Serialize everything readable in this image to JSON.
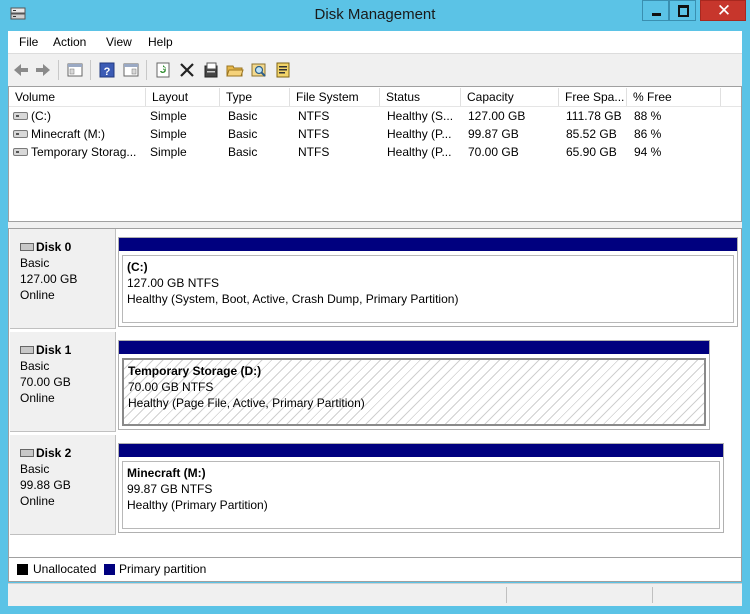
{
  "window": {
    "title": "Disk Management"
  },
  "menu": [
    "File",
    "Action",
    "View",
    "Help"
  ],
  "toolbar_icons": [
    "back-arrow-icon",
    "forward-arrow-icon",
    "console-tree-icon",
    "help-icon",
    "properties-pane-icon",
    "refresh-icon",
    "delete-icon",
    "properties-icon",
    "open-icon",
    "explore-icon",
    "export-icon"
  ],
  "volumes": {
    "columns": [
      "Volume",
      "Layout",
      "Type",
      "File System",
      "Status",
      "Capacity",
      "Free Spa...",
      "% Free"
    ],
    "rows": [
      {
        "volume": "(C:)",
        "layout": "Simple",
        "type": "Basic",
        "fs": "NTFS",
        "status": "Healthy (S...",
        "capacity": "127.00 GB",
        "free": "111.78 GB",
        "pct": "88 %"
      },
      {
        "volume": "Minecraft (M:)",
        "layout": "Simple",
        "type": "Basic",
        "fs": "NTFS",
        "status": "Healthy (P...",
        "capacity": "99.87 GB",
        "free": "85.52 GB",
        "pct": "86 %"
      },
      {
        "volume": "Temporary Storag...",
        "layout": "Simple",
        "type": "Basic",
        "fs": "NTFS",
        "status": "Healthy (P...",
        "capacity": "70.00 GB",
        "free": "65.90 GB",
        "pct": "94 %"
      }
    ]
  },
  "disks": [
    {
      "name": "Disk 0",
      "kind": "Basic",
      "size": "127.00 GB",
      "state": "Online",
      "partition": {
        "title": "(C:)",
        "size_fs": "127.00 GB NTFS",
        "status": "Healthy (System, Boot, Active, Crash Dump, Primary Partition)"
      }
    },
    {
      "name": "Disk 1",
      "kind": "Basic",
      "size": "70.00 GB",
      "state": "Online",
      "partition": {
        "title": "Temporary Storage  (D:)",
        "size_fs": "70.00 GB NTFS",
        "status": "Healthy (Page File, Active, Primary Partition)"
      }
    },
    {
      "name": "Disk 2",
      "kind": "Basic",
      "size": "99.88 GB",
      "state": "Online",
      "partition": {
        "title": "Minecraft  (M:)",
        "size_fs": "99.87 GB NTFS",
        "status": "Healthy (Primary Partition)"
      }
    }
  ],
  "legend": [
    {
      "label": "Unallocated",
      "color": "#000000"
    },
    {
      "label": "Primary partition",
      "color": "#00007f"
    }
  ],
  "colors": {
    "titlebar": "#5bc3e6",
    "partition_bar": "#00007f",
    "close_button": "#c7362c"
  }
}
